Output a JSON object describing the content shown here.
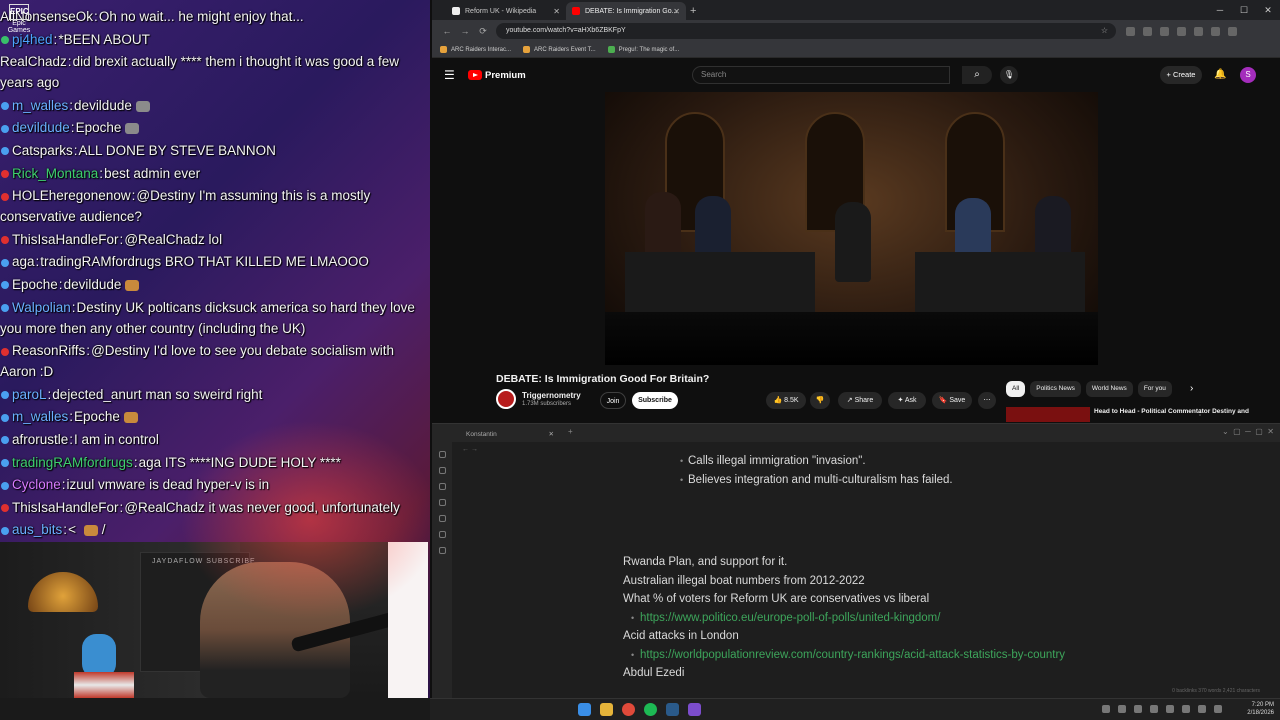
{
  "chat": {
    "messages": [
      {
        "user": "AllNonsenseOk",
        "color": "#f4f4f4",
        "text": "Oh no wait... he might enjoy that...",
        "dot": "none"
      },
      {
        "user": "pj4hed",
        "color": "#4da3ff",
        "text": "*BEEN ABOUT",
        "dot": "green"
      },
      {
        "user": "RealChadz",
        "color": "#f4f4f4",
        "text": "did brexit actually **** them i thought it was good a few years ago",
        "dot": "none"
      },
      {
        "user": "m_walles",
        "color": "#6ab0ff",
        "text": "devildude",
        "dot": "blue",
        "emote": "gray"
      },
      {
        "user": "devildude",
        "color": "#6ab0ff",
        "text": "Epoche",
        "dot": "blue",
        "emote": "gray"
      },
      {
        "user": "Catsparks",
        "color": "#f4f4f4",
        "text": "ALL DONE BY STEVE BANNON",
        "dot": "blue"
      },
      {
        "user": "Rick_Montana",
        "color": "#3ecf6e",
        "text": "best admin ever",
        "dot": "red"
      },
      {
        "user": "HOLEheregonenow",
        "color": "#f4f4f4",
        "text": "@Destiny I'm assuming this is a mostly conservative audience?",
        "dot": "red"
      },
      {
        "user": "ThisIsaHandleFor",
        "color": "#f4f4f4",
        "text": "@RealChadz lol",
        "dot": "red"
      },
      {
        "user": "aga",
        "color": "#f4f4f4",
        "text": "tradingRAMfordrugs BRO THAT KILLED ME LMAOOO",
        "dot": "blue"
      },
      {
        "user": "Epoche",
        "color": "#f4f4f4",
        "text": "devildude",
        "dot": "blue",
        "emote": "brown"
      },
      {
        "user": "Walpolian",
        "color": "#6ab0ff",
        "text": "Destiny UK polticans dicksuck america so hard they love you more then any other country (including the UK)",
        "dot": "blue"
      },
      {
        "user": "ReasonRiffs",
        "color": "#f4f4f4",
        "text": "@Destiny I'd love to see you debate socialism with Aaron :D",
        "dot": "red"
      },
      {
        "user": "paroL",
        "color": "#6ab0ff",
        "text": "dejected_anurt man so sweird right",
        "dot": "blue"
      },
      {
        "user": "m_walles",
        "color": "#6ab0ff",
        "text": "Epoche",
        "dot": "blue",
        "emote": "brown"
      },
      {
        "user": "afrorustle",
        "color": "#f4f4f4",
        "text": "I am in control",
        "dot": "blue"
      },
      {
        "user": "tradingRAMfordrugs",
        "color": "#3ecf6e",
        "text": "aga ITS ****ING",
        "dot": "blue",
        "text2": "DUDE HOLY ****"
      },
      {
        "user": "Cyclone",
        "color": "#d97cff",
        "text": "izuul vmware is dead hyper-v is in",
        "dot": "blue"
      },
      {
        "user": "ThisIsaHandleFor",
        "color": "#f4f4f4",
        "text": "@RealChadz it was never good, unfortunately",
        "dot": "red"
      },
      {
        "user": "aus_bits",
        "color": "#6ab0ff",
        "text": "< ",
        "dot": "blue",
        "emote": "brown",
        "text2": "/"
      }
    ],
    "dot_colors": {
      "red": "#e0302f",
      "blue": "#4aa0f0",
      "green": "#39c06a"
    }
  },
  "epic": {
    "logo": "EPIC",
    "label": "Epic Games"
  },
  "webcam": {
    "brand": "JAYDAFLOW SUBSCRIBE"
  },
  "browser": {
    "tabs": [
      {
        "title": "Reform UK - Wikipedia",
        "active": false,
        "fav": "#eeeeee"
      },
      {
        "title": "DEBATE: Is Immigration Go...",
        "active": true,
        "fav": "#ff0000"
      }
    ],
    "url": "youtube.com/watch?v=aHXb6ZBKFpY",
    "bookmarks": [
      {
        "label": "ARC Raiders Interac...",
        "color": "#e6a23c"
      },
      {
        "label": "ARC Raiders Event T...",
        "color": "#e6a23c"
      },
      {
        "label": "Pregu!: The magic of...",
        "color": "#4caf50"
      }
    ]
  },
  "youtube": {
    "brand": "Premium",
    "search_placeholder": "Search",
    "create_label": "Create",
    "avatar_letter": "S",
    "video_title": "DEBATE: Is Immigration Good For Britain?",
    "channel_name": "Triggernometry",
    "subscribers": "1.73M subscribers",
    "join_label": "Join",
    "subscribe_label": "Subscribe",
    "likes": "8.5K",
    "share_label": "Share",
    "ask_label": "Ask",
    "save_label": "Save",
    "chips": [
      "All",
      "Politics News",
      "World News",
      "For you"
    ],
    "suggested_title": "Head to Head - Political Commentator Destiny and"
  },
  "notes": {
    "tab_title": "Konstantin",
    "bullets": [
      "Calls illegal immigration \"invasion\".",
      "Believes integration and multi-culturalism has failed."
    ],
    "lines": [
      {
        "type": "p",
        "text": "Rwanda Plan, and support for it."
      },
      {
        "type": "p",
        "text": "Australian illegal boat numbers from 2012-2022"
      },
      {
        "type": "p",
        "text": "What % of voters for Reform UK are conservatives vs liberal"
      },
      {
        "type": "link",
        "text": "https://www.politico.eu/europe-poll-of-polls/united-kingdom/"
      },
      {
        "type": "p",
        "text": "Acid attacks in London"
      },
      {
        "type": "link",
        "text": "https://worldpopulationreview.com/country-rankings/acid-attack-statistics-by-country"
      },
      {
        "type": "p",
        "text": "Abdul Ezedi"
      }
    ],
    "status": "0 backlinks   370 words   2,421 characters"
  },
  "taskbar": {
    "time": "7:20 PM",
    "date": "2/18/2026"
  }
}
